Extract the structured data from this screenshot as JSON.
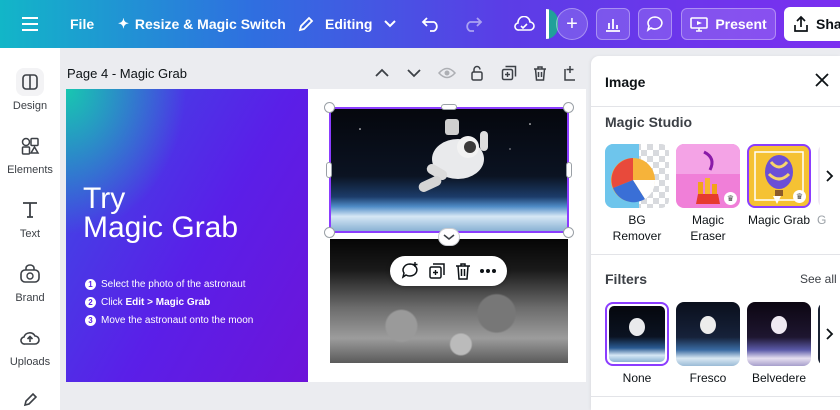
{
  "topbar": {
    "file": "File",
    "resize": "Resize & Magic Switch",
    "editing": "Editing",
    "present": "Present",
    "share": "Sha"
  },
  "rail": {
    "items": [
      {
        "label": "Design",
        "icon": "design-icon"
      },
      {
        "label": "Elements",
        "icon": "elements-icon"
      },
      {
        "label": "Text",
        "icon": "text-icon"
      },
      {
        "label": "Brand",
        "icon": "brand-icon"
      },
      {
        "label": "Uploads",
        "icon": "uploads-icon"
      }
    ]
  },
  "canvas": {
    "page_title": "Page 4 - Magic Grab",
    "slide": {
      "heading_line1": "Try",
      "heading_line2": "Magic Grab",
      "steps": [
        {
          "num": "1",
          "text": "Select the photo of the astronaut",
          "bold": ""
        },
        {
          "num": "2",
          "text": "Click ",
          "bold": "Edit > Magic Grab"
        },
        {
          "num": "3",
          "text": "Move the astronaut onto the moon",
          "bold": ""
        }
      ]
    }
  },
  "panel": {
    "title": "Image",
    "magic_studio": {
      "title": "Magic Studio",
      "tools": [
        {
          "label_line1": "BG",
          "label_line2": "Remover"
        },
        {
          "label_line1": "Magic",
          "label_line2": "Eraser"
        },
        {
          "label_line1": "Magic Grab",
          "label_line2": ""
        },
        {
          "label_line1": "G",
          "label_line2": ""
        }
      ]
    },
    "filters": {
      "title": "Filters",
      "see_all": "See all",
      "items": [
        "None",
        "Fresco",
        "Belvedere"
      ]
    }
  },
  "colors": {
    "accent": "#8b3dff",
    "topbar_start": "#12b6c8",
    "topbar_end": "#7b2ff0"
  }
}
